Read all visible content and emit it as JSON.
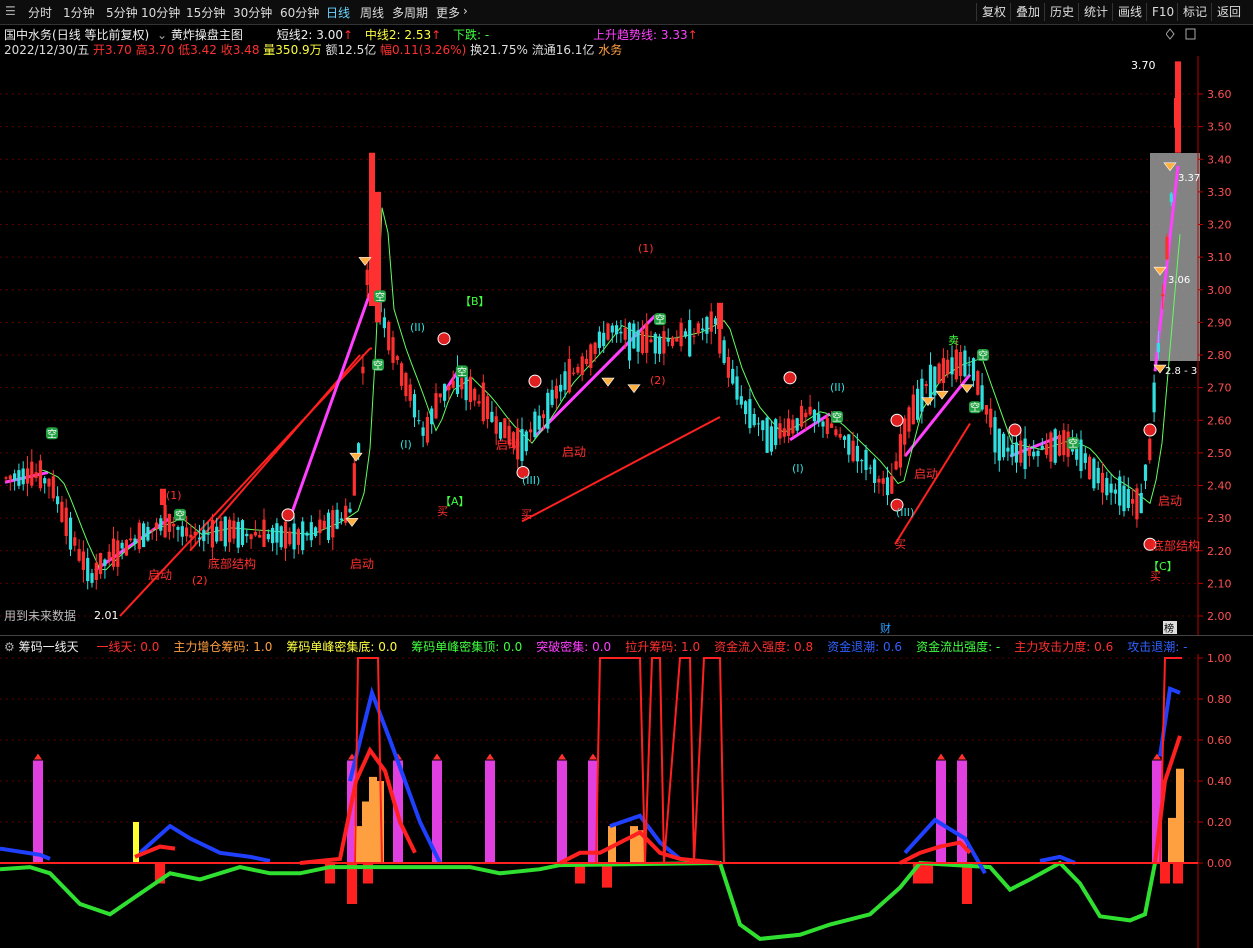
{
  "toolbar": {
    "tabs": [
      "分时",
      "1分钟",
      "5分钟",
      "10分钟",
      "15分钟",
      "30分钟",
      "60分钟",
      "日线",
      "周线",
      "多周期",
      "更多"
    ],
    "active_tab": "日线",
    "right_buttons": [
      "复权",
      "叠加",
      "历史",
      "统计",
      "画线",
      "F10",
      "标记",
      "返回"
    ]
  },
  "header": {
    "stock_name": "国中水务",
    "period_info": "(日线 等比前复权)",
    "indicator_name": "黄炸操盘主图",
    "short_line": "短线2: 3.00",
    "mid_line": "中线2: 2.53",
    "down_label": "下跌: -",
    "trend_line": "上升趋势线: 3.33",
    "date": "2022/12/30/五",
    "open": "开3.70",
    "high": "高3.70",
    "low": "低3.42",
    "close": "收3.48",
    "volume": "量350.9万",
    "amount": "额12.5亿",
    "change": "幅0.11(3.26%)",
    "turnover": "换21.75%",
    "float_cap": "流通16.1亿",
    "sector": "水务"
  },
  "main_axis": {
    "ticks": [
      "3.60",
      "3.50",
      "3.40",
      "3.30",
      "3.20",
      "3.10",
      "3.00",
      "2.90",
      "2.80",
      "2.70",
      "2.60",
      "2.50",
      "2.40",
      "2.30",
      "2.20",
      "2.10",
      "2.00"
    ],
    "high_mark": "3.70",
    "low_mark": "2.01"
  },
  "main_labels": {
    "future_data": "用到未来数据",
    "box_a": "【A】",
    "box_b": "【B】",
    "box_c": "【C】",
    "buy": "买",
    "sell": "卖",
    "start": "启动",
    "bottom_structure": "底部结构",
    "empty": "空",
    "wave_i": "(I)",
    "wave_ii": "(II)",
    "wave_iii": "(III)",
    "num_1": "(1)",
    "num_2": "(2)",
    "cai": "财",
    "bang": "榜",
    "v337": "3.37",
    "v306": "3.06",
    "v283": "2.8 - 3"
  },
  "indicator": {
    "name": "筹码一线天",
    "items": [
      {
        "label": "一线天: 0.0",
        "color": "#ff3030"
      },
      {
        "label": "主力增仓筹码: 1.0",
        "color": "#ffa040"
      },
      {
        "label": "筹码单峰密集底: 0.0",
        "color": "#ffff40"
      },
      {
        "label": "筹码单峰密集顶: 0.0",
        "color": "#40ff40"
      },
      {
        "label": "突破密集: 0.0",
        "color": "#ff40ff"
      },
      {
        "label": "拉升筹码: 1.0",
        "color": "#ff3030"
      },
      {
        "label": "资金流入强度: 0.8",
        "color": "#ff3030"
      },
      {
        "label": "资金退潮: 0.6",
        "color": "#3060ff"
      },
      {
        "label": "资金流出强度: -",
        "color": "#40ff40"
      },
      {
        "label": "主力攻击力度: 0.6",
        "color": "#ff3030"
      },
      {
        "label": "攻击退潮: -",
        "color": "#3060ff"
      }
    ],
    "axis_ticks": [
      "1.00",
      "0.80",
      "0.60",
      "0.40",
      "0.20",
      "0.00"
    ]
  },
  "colors": {
    "up": "#ff3030",
    "down": "#30e0e0",
    "trend_line": "#ff40ff",
    "background": "#000000"
  }
}
